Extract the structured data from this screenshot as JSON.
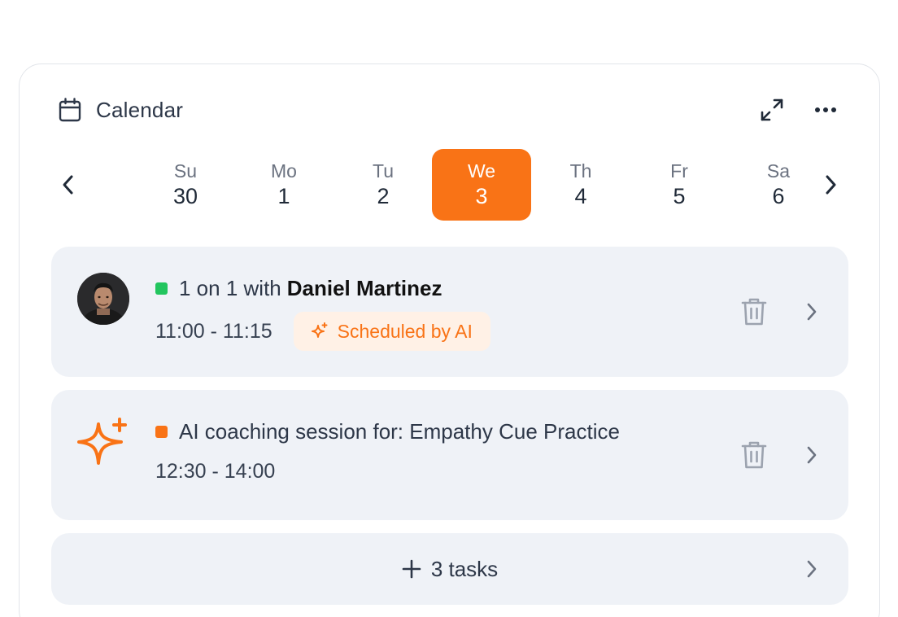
{
  "calendar": {
    "title": "Calendar",
    "icon": "calendar-icon",
    "actions": [
      "expand-icon",
      "more-icon"
    ]
  },
  "week": {
    "days": [
      {
        "name": "Su",
        "num": "30"
      },
      {
        "name": "Mo",
        "num": "1"
      },
      {
        "name": "Tu",
        "num": "2"
      },
      {
        "name": "We",
        "num": "3"
      },
      {
        "name": "Th",
        "num": "4"
      },
      {
        "name": "Fr",
        "num": "5"
      },
      {
        "name": "Sa",
        "num": "6"
      }
    ],
    "selected_index": 3
  },
  "events": [
    {
      "title_prefix": "1 on 1 with",
      "title_name": "Daniel Martinez",
      "time": "11:00 - 11:15",
      "badge": "Scheduled by AI",
      "status_color": "#22c55e"
    },
    {
      "title_prefix": "AI coaching session for: Empathy Cue Practice",
      "time": "12:30 - 14:00",
      "status_color": "#f97316"
    }
  ],
  "tasks": {
    "label": "3 tasks"
  },
  "colors": {
    "accent": "#f97316",
    "card_bg": "#eff2f7",
    "muted_icon": "#9ca3af"
  }
}
